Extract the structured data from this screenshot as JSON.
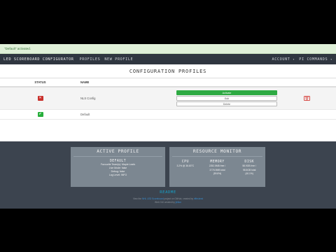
{
  "alert": {
    "text": "\"Default\" activated."
  },
  "navbar": {
    "brand": "LED SCOREBOARD CONFIGURATOR",
    "links": [
      "PROFILES",
      "NEW PROFILE"
    ],
    "account": "ACCOUNT",
    "pi_commands": "PI COMMANDS",
    "caret": "▾"
  },
  "page": {
    "title": "CONFIGURATION PROFILES"
  },
  "table": {
    "headers": {
      "status": "STATUS",
      "name": "NAME"
    },
    "rows": [
      {
        "status_icon": "x-icon",
        "status_glyph": "✕",
        "name": "NLS Config",
        "buttons": [
          "Activate",
          "Edit",
          "Delete"
        ],
        "delete_glyph": "🗑"
      },
      {
        "status_icon": "check-icon",
        "status_glyph": "✔",
        "name": "Default"
      }
    ]
  },
  "active_profile": {
    "title": "ACTIVE PROFILE",
    "name": "DEFAULT",
    "details": [
      "Favourite Team(s): Maple Leafs",
      "Live Mode: false",
      "Debug: false",
      "Log Level: INFO"
    ]
  },
  "resource_monitor": {
    "title": "RESOURCE MONITOR",
    "cpu": {
      "label": "CPU",
      "lines": [
        "3.2% @ 36.63°C"
      ]
    },
    "memory": {
      "label": "MEMORY",
      "lines": [
        "2252.5MB free /",
        "3776.9MB total",
        "(59.8%)"
      ]
    },
    "disk": {
      "label": "DISK",
      "lines": [
        "58.9GB free /",
        "98.5GB total",
        "(40.1%)"
      ]
    }
  },
  "footer": {
    "readme": "README",
    "credit_line1_prefix": "View the ",
    "credit_line1_link": "NHL LED Scoreboard",
    "credit_line1_mid": " project on GitHub, created by ",
    "credit_line1_author": "riffnshred",
    "credit_line2_prefix": "Web GUI created by ",
    "credit_line2_author": "jhilton",
    "colors": {
      "accent": "#17a2c8",
      "footer_bg": "#3c444f",
      "panel_bg": "#7c8791",
      "navbar_bg": "#2f3640"
    }
  }
}
